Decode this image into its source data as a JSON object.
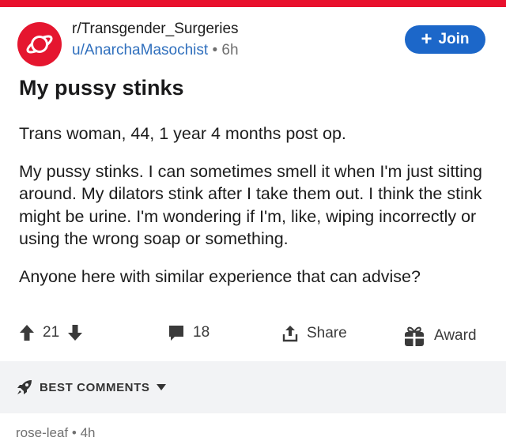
{
  "colors": {
    "accent_red": "#e8112d",
    "link_blue": "#2f6fbd",
    "join_blue": "#1c67c9"
  },
  "post": {
    "subreddit": "r/Transgender_Surgeries",
    "author": "u/AnarchaMasochist",
    "separator": "•",
    "time": "6h",
    "join_label": "Join",
    "title": "My pussy stinks",
    "body": [
      "Trans woman, 44, 1 year 4 months post op.",
      "My pussy stinks. I can sometimes smell it when I'm just sitting around. My dilators stink after I take them out. I think the stink might be urine. I'm wondering if I'm, like, wiping incorrectly or using the wrong soap or something.",
      "Anyone here with similar experience that can advise?"
    ],
    "actions": {
      "score": "21",
      "comments": "18",
      "share": "Share",
      "award": "Award"
    }
  },
  "comments_header": {
    "label": "BEST COMMENTS"
  },
  "first_comment": {
    "author": "rose-leaf",
    "separator": "•",
    "time": "4h"
  },
  "icons": [
    "subreddit-planet-icon",
    "plus-icon",
    "upvote-icon",
    "downvote-icon",
    "comment-icon",
    "share-icon",
    "gift-icon",
    "rocket-icon",
    "caret-down-icon"
  ]
}
